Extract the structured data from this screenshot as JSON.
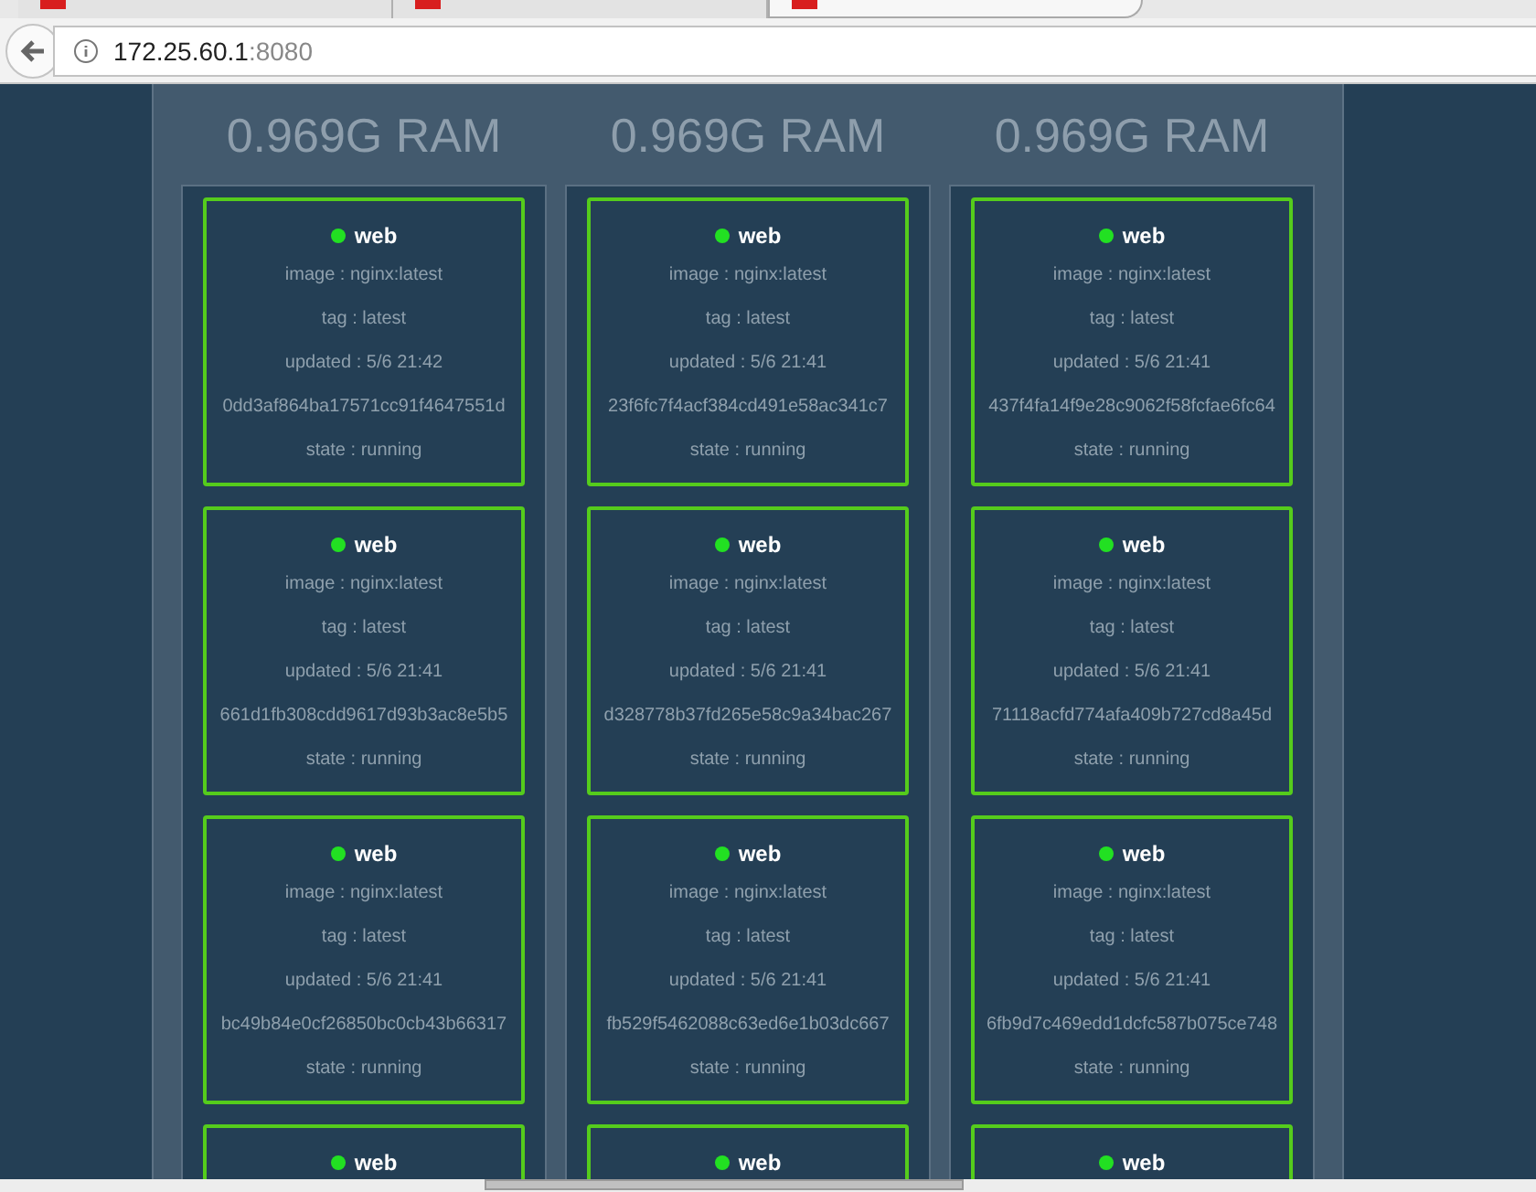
{
  "browser": {
    "tabs": [
      {
        "selected": false
      },
      {
        "selected": false
      },
      {
        "selected": true
      }
    ],
    "address": {
      "host": "172.25.60.1",
      "port": ":8080"
    }
  },
  "nodes": [
    {
      "ram": "0.969G RAM",
      "containers": [
        {
          "name": "web",
          "color": "#22e022",
          "image": "image : nginx:latest",
          "tag": "tag : latest",
          "updated": "updated : 5/6 21:42",
          "id": "0dd3af864ba17571cc91f4647551d",
          "state": "state : running"
        },
        {
          "name": "web",
          "color": "#22e022",
          "image": "image : nginx:latest",
          "tag": "tag : latest",
          "updated": "updated : 5/6 21:41",
          "id": "661d1fb308cdd9617d93b3ac8e5b5",
          "state": "state : running"
        },
        {
          "name": "web",
          "color": "#22e022",
          "image": "image : nginx:latest",
          "tag": "tag : latest",
          "updated": "updated : 5/6 21:41",
          "id": "bc49b84e0cf26850bc0cb43b66317",
          "state": "state : running"
        },
        {
          "name": "web",
          "color": "#22e022"
        }
      ]
    },
    {
      "ram": "0.969G RAM",
      "containers": [
        {
          "name": "web",
          "color": "#22e022",
          "image": "image : nginx:latest",
          "tag": "tag : latest",
          "updated": "updated : 5/6 21:41",
          "id": "23f6fc7f4acf384cd491e58ac341c7",
          "state": "state : running"
        },
        {
          "name": "web",
          "color": "#22e022",
          "image": "image : nginx:latest",
          "tag": "tag : latest",
          "updated": "updated : 5/6 21:41",
          "id": "d328778b37fd265e58c9a34bac267",
          "state": "state : running"
        },
        {
          "name": "web",
          "color": "#22e022",
          "image": "image : nginx:latest",
          "tag": "tag : latest",
          "updated": "updated : 5/6 21:41",
          "id": "fb529f5462088c63ed6e1b03dc667",
          "state": "state : running"
        },
        {
          "name": "web",
          "color": "#22e022"
        }
      ]
    },
    {
      "ram": "0.969G RAM",
      "containers": [
        {
          "name": "web",
          "color": "#22e022",
          "image": "image : nginx:latest",
          "tag": "tag : latest",
          "updated": "updated : 5/6 21:41",
          "id": "437f4fa14f9e28c9062f58fcfae6fc64",
          "state": "state : running"
        },
        {
          "name": "web",
          "color": "#22e022",
          "image": "image : nginx:latest",
          "tag": "tag : latest",
          "updated": "updated : 5/6 21:41",
          "id": "71118acfd774afa409b727cd8a45d",
          "state": "state : running"
        },
        {
          "name": "web",
          "color": "#22e022",
          "image": "image : nginx:latest",
          "tag": "tag : latest",
          "updated": "updated : 5/6 21:41",
          "id": "6fb9d7c469edd1dcfc587b075ce748",
          "state": "state : running"
        },
        {
          "name": "web",
          "color": "#22e022"
        }
      ]
    }
  ]
}
